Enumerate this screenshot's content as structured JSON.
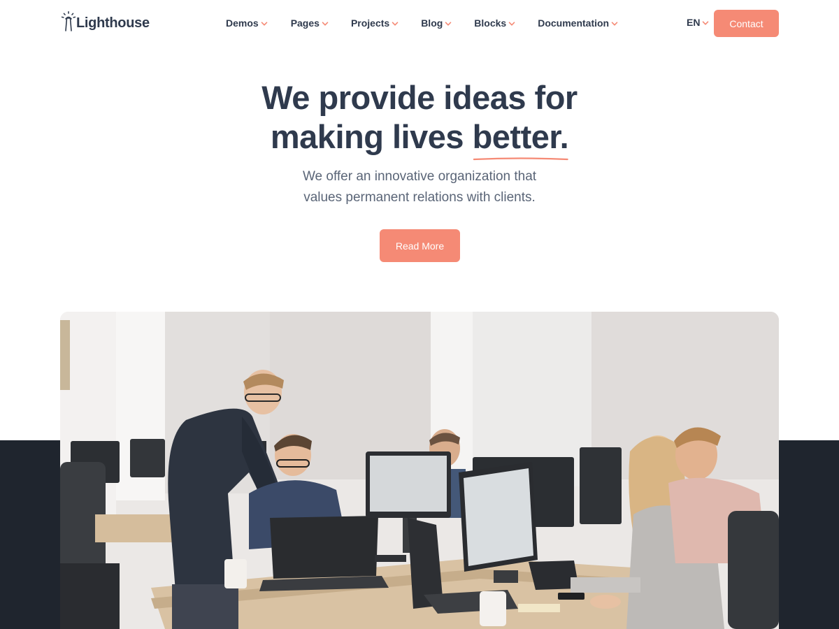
{
  "brand": {
    "name": "Lighthouse",
    "accent_color": "#f58a75",
    "text_color": "#2f3a4d",
    "dark_band_color": "#1f252e"
  },
  "nav": {
    "items": [
      {
        "label": "Demos",
        "icon": "chevron-down-icon"
      },
      {
        "label": "Pages",
        "icon": "chevron-down-icon"
      },
      {
        "label": "Projects",
        "icon": "chevron-down-icon"
      },
      {
        "label": "Blog",
        "icon": "chevron-down-icon"
      },
      {
        "label": "Blocks",
        "icon": "chevron-down-icon"
      },
      {
        "label": "Documentation",
        "icon": "chevron-down-icon"
      }
    ],
    "language": "EN",
    "contact_label": "Contact"
  },
  "hero": {
    "title_line1": "We provide ideas for",
    "title_line2_prefix": "making lives ",
    "title_highlight": "better.",
    "subtitle_line1": "We offer an innovative organization that",
    "subtitle_line2": "values permanent relations with clients.",
    "cta_label": "Read More"
  },
  "image": {
    "icon": "office-team-photo"
  }
}
